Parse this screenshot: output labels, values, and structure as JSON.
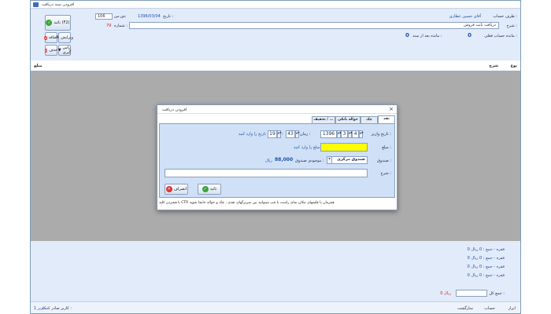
{
  "window": {
    "title": "افزودن سند دریافت"
  },
  "header": {
    "party_label": "طرف حساب :",
    "party_value": "آقای حسین عطاری",
    "date_label": "تاریخ :",
    "date_value": "1396/03/04",
    "ref_label": "ش.س:",
    "ref_value": "106",
    "desc_label": "شرح :",
    "desc_value": "دریافت بابت فروش",
    "number_label": "شماره :",
    "number_value": "79",
    "balance_label": "مانده حساب فعلی :",
    "balance_value": "0",
    "after_label": "مانده بعد از سند :",
    "after_value": "0"
  },
  "buttons": {
    "confirm": "تائید (F2)",
    "edit": "ویرایش",
    "add": "اضافه",
    "remove": "حذف",
    "right_click": "راس گیری"
  },
  "grid": {
    "columns": [
      "نوع",
      "شرح",
      "مبلغ"
    ]
  },
  "dialog": {
    "title": "افزودن دریافت",
    "tabs": [
      "نقد",
      "چک",
      "حواله بانکی",
      "تخفیف / ..."
    ],
    "deposit_date_label": "تاریخ واریز :",
    "year": "1396",
    "month": "3",
    "day": "4",
    "time_label": "زمان :",
    "hour": "19",
    "minute": "43",
    "time_hint": "تاریخ را وارد کنید",
    "amount_label": "مبلغ :",
    "amount_value": "",
    "amount_hint": "مبلغ را وارد کنید",
    "fund_label": "صندوق :",
    "fund_value": "صندوق مرکزی",
    "fund_balance_label": "موجودی صندوق :",
    "fund_balance_value": "88,000",
    "fund_balance_unit": "ریال",
    "note_label": "شرح :",
    "confirm_btn": "تائید",
    "cancel_btn": "انصراف",
    "status": "با فشردن کلید CTR همزمان با فلشهای مکان نمای راست یا چپ میتوانید بین سربرگهای نقدی ، چک و حواله جابجا شوید"
  },
  "summary": {
    "lines": [
      "0 فقره - جمع : 0 ریال",
      "0 فقره - جمع : 0 ریال",
      "0 فقره - جمع : 0 ریال",
      "0 فقره - جمع : 0 ریال"
    ],
    "total_label": "جمع کل :",
    "total_value": "0 ریال"
  },
  "statusbar": {
    "issuer": "کاربر صادر کننده :",
    "user": "کاربر 1",
    "items": [
      "سازگشت",
      "حساب",
      "ابزار"
    ]
  }
}
